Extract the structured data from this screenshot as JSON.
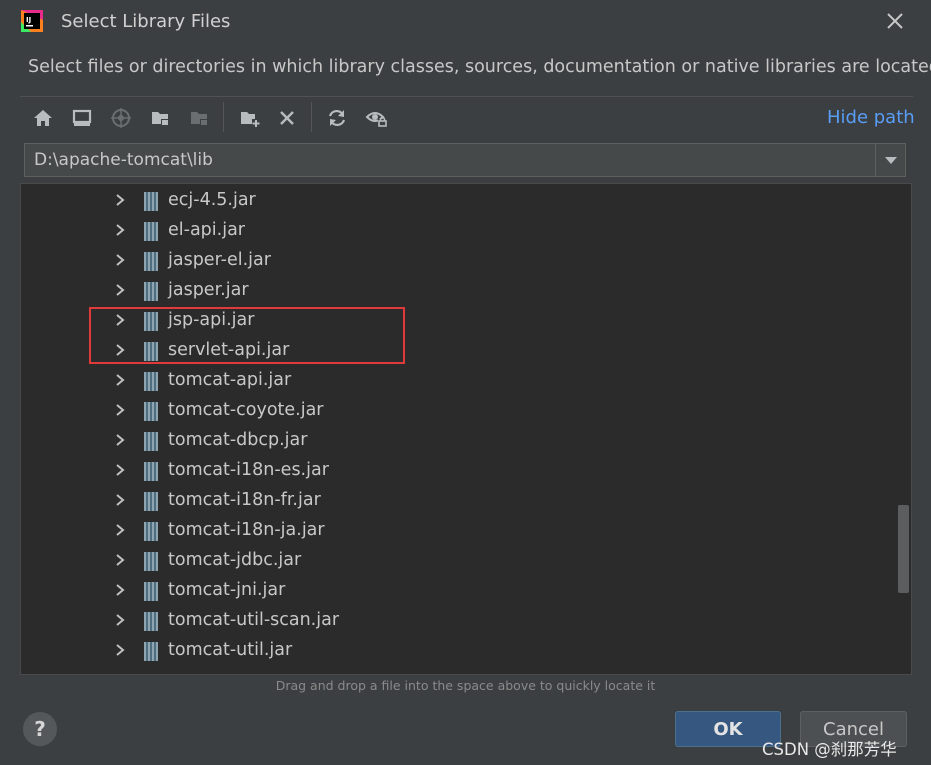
{
  "window": {
    "title": "Select Library Files"
  },
  "description": "Select files or directories in which library classes, sources, documentation or native libraries are located",
  "toolbar": {
    "buttons": [
      "home-icon",
      "desktop-icon",
      "project-icon",
      "module-folder-icon",
      "module-folder-disabled-icon",
      "new-folder-icon",
      "delete-icon",
      "refresh-icon",
      "show-hidden-icon"
    ],
    "hide_path_label": "Hide path"
  },
  "path": {
    "value": "D:\\apache-tomcat\\lib"
  },
  "files": [
    "ecj-4.5.jar",
    "el-api.jar",
    "jasper-el.jar",
    "jasper.jar",
    "jsp-api.jar",
    "servlet-api.jar",
    "tomcat-api.jar",
    "tomcat-coyote.jar",
    "tomcat-dbcp.jar",
    "tomcat-i18n-es.jar",
    "tomcat-i18n-fr.jar",
    "tomcat-i18n-ja.jar",
    "tomcat-jdbc.jar",
    "tomcat-jni.jar",
    "tomcat-util-scan.jar",
    "tomcat-util.jar"
  ],
  "highlighted_files": [
    "jsp-api.jar",
    "servlet-api.jar"
  ],
  "hint": "Drag and drop a file into the space above to quickly locate it",
  "buttons": {
    "help": "?",
    "ok": "OK",
    "cancel": "Cancel"
  },
  "watermark": "CSDN @刹那芳华",
  "colors": {
    "accent": "#589df6",
    "highlight_box": "#e03a3a",
    "ok_bg": "#365880"
  }
}
